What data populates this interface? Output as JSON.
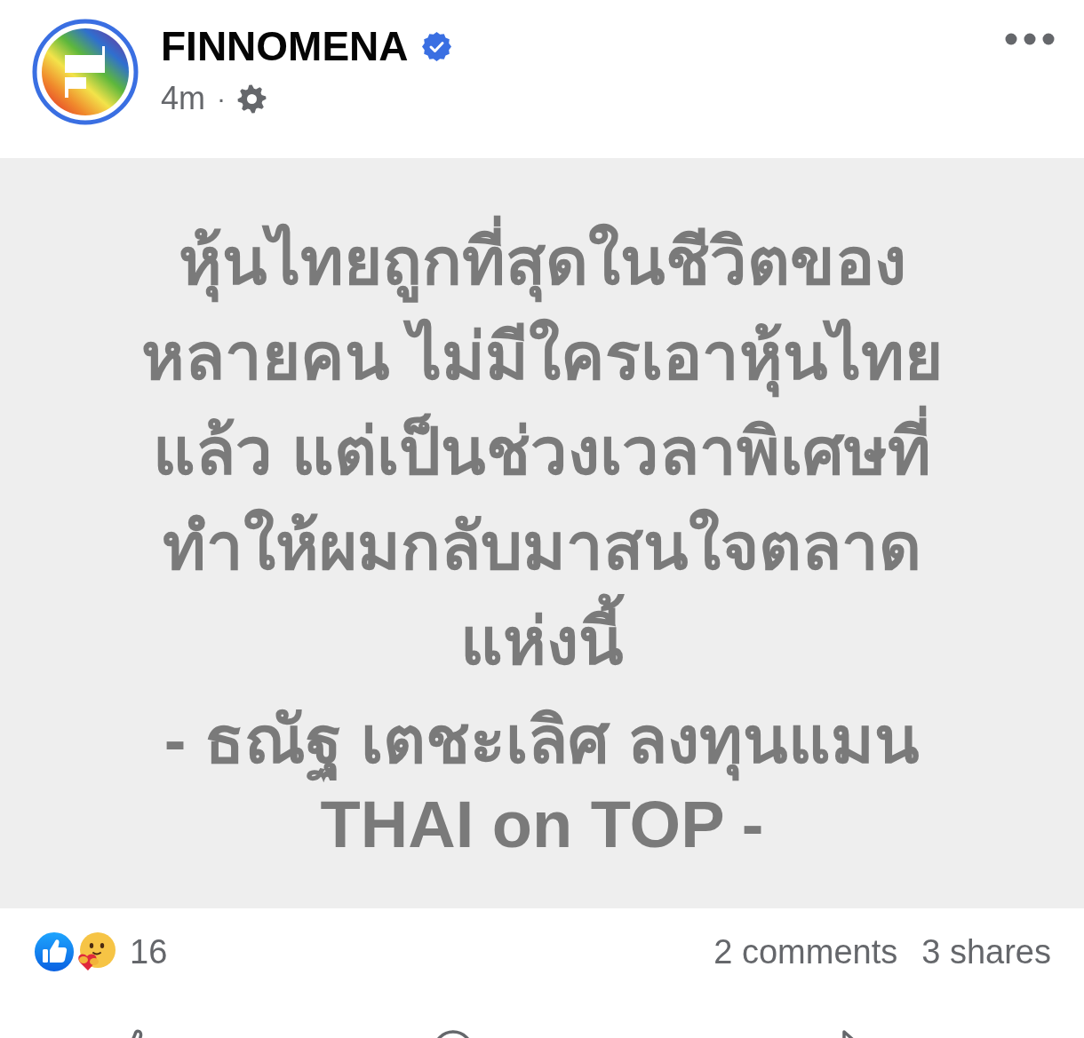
{
  "header": {
    "page_name": "FINNOMENA",
    "verified": true,
    "time": "4m",
    "separator": "·"
  },
  "post": {
    "quote_lines": [
      "หุ้นไทยถูกที่สุดในชีวิตของ",
      "หลายคน ไม่มีใครเอาหุ้นไทย",
      "แล้ว แต่เป็นช่วงเวลาพิเศษที่",
      "ทำให้ผมกลับมาสนใจตลาด",
      "แห่งนี้"
    ],
    "attribution_lines": [
      "- ธณัฐ เตชะเลิศ ลงทุนแมน",
      "THAI on TOP -"
    ]
  },
  "stats": {
    "reaction_count": "16",
    "comments": "2 comments",
    "shares": "3 shares"
  }
}
